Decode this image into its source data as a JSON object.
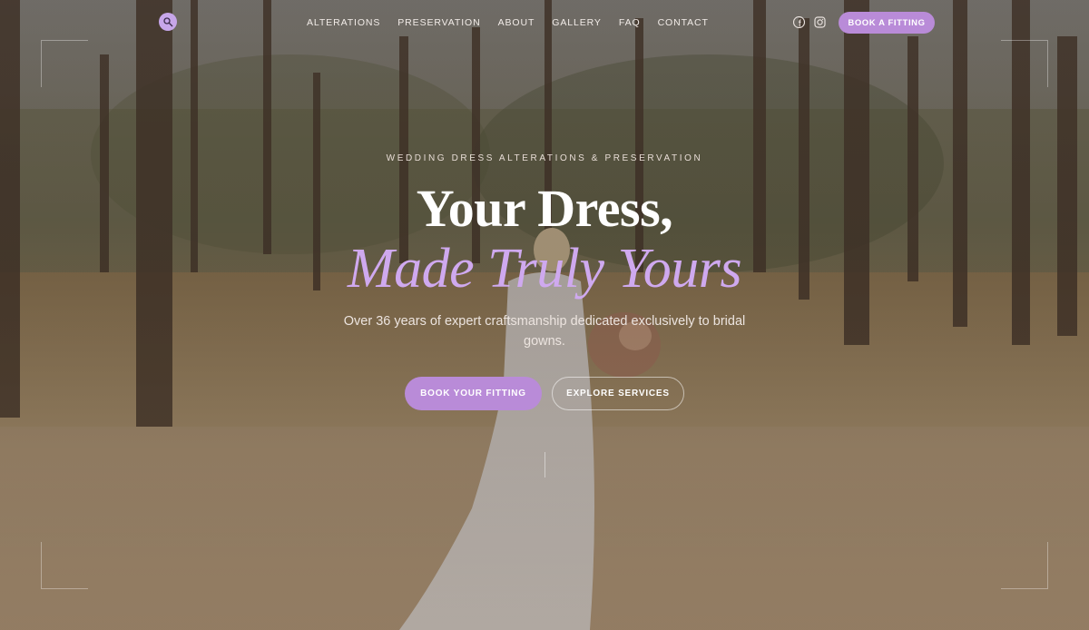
{
  "nav": {
    "logo_icon": "monogram-logo-icon",
    "items": [
      {
        "label": "ALTERATIONS"
      },
      {
        "label": "PRESERVATION"
      },
      {
        "label": "ABOUT"
      },
      {
        "label": "GALLERY"
      },
      {
        "label": "FAQ"
      },
      {
        "label": "CONTACT"
      }
    ],
    "social": [
      "facebook-icon",
      "instagram-icon"
    ],
    "cta_label": "BOOK A FITTING"
  },
  "hero": {
    "eyebrow": "WEDDING DRESS ALTERATIONS & PRESERVATION",
    "title_line1": "Your Dress,",
    "title_line2": "Made Truly Yours",
    "subtitle": "Over 36 years of expert craftsmanship dedicated exclusively to bridal gowns.",
    "primary_button": "BOOK YOUR FITTING",
    "secondary_button": "EXPLORE SERVICES"
  },
  "colors": {
    "accent": "#b98bd8",
    "title_accent": "#cfa9ef",
    "text_light": "#ffffff"
  }
}
